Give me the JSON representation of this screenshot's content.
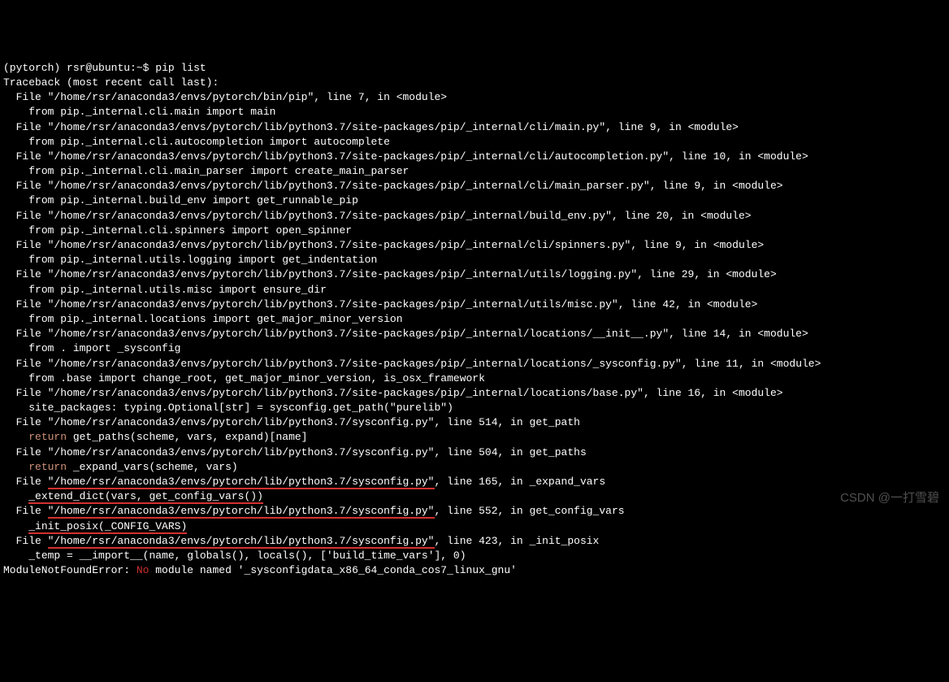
{
  "prompt": {
    "env": "(pytorch)",
    "user_host": "rsr@ubuntu",
    "path": "~",
    "symbol": "$",
    "command": "pip list"
  },
  "traceback": {
    "header": "Traceback (most recent call last):",
    "frames": [
      {
        "file": "\"/home/rsr/anaconda3/envs/pytorch/bin/pip\"",
        "line": "7",
        "func": "<module>",
        "code": "from pip._internal.cli.main import main"
      },
      {
        "file": "\"/home/rsr/anaconda3/envs/pytorch/lib/python3.7/site-packages/pip/_internal/cli/main.py\"",
        "line": "9",
        "func": "<module>",
        "code": "from pip._internal.cli.autocompletion import autocomplete"
      },
      {
        "file": "\"/home/rsr/anaconda3/envs/pytorch/lib/python3.7/site-packages/pip/_internal/cli/autocompletion.py\"",
        "line": "10",
        "func": "<module>",
        "code": "from pip._internal.cli.main_parser import create_main_parser"
      },
      {
        "file": "\"/home/rsr/anaconda3/envs/pytorch/lib/python3.7/site-packages/pip/_internal/cli/main_parser.py\"",
        "line": "9",
        "func": "<module>",
        "code": "from pip._internal.build_env import get_runnable_pip"
      },
      {
        "file": "\"/home/rsr/anaconda3/envs/pytorch/lib/python3.7/site-packages/pip/_internal/build_env.py\"",
        "line": "20",
        "func": "<module>",
        "code": "from pip._internal.cli.spinners import open_spinner"
      },
      {
        "file": "\"/home/rsr/anaconda3/envs/pytorch/lib/python3.7/site-packages/pip/_internal/cli/spinners.py\"",
        "line": "9",
        "func": "<module>",
        "code": "from pip._internal.utils.logging import get_indentation"
      },
      {
        "file": "\"/home/rsr/anaconda3/envs/pytorch/lib/python3.7/site-packages/pip/_internal/utils/logging.py\"",
        "line": "29",
        "func": "<module>",
        "code": "from pip._internal.utils.misc import ensure_dir"
      },
      {
        "file": "\"/home/rsr/anaconda3/envs/pytorch/lib/python3.7/site-packages/pip/_internal/utils/misc.py\"",
        "line": "42",
        "func": "<module>",
        "code": "from pip._internal.locations import get_major_minor_version"
      },
      {
        "file": "\"/home/rsr/anaconda3/envs/pytorch/lib/python3.7/site-packages/pip/_internal/locations/__init__.py\"",
        "line": "14",
        "func": "<module>",
        "code": "from . import _sysconfig"
      },
      {
        "file": "\"/home/rsr/anaconda3/envs/pytorch/lib/python3.7/site-packages/pip/_internal/locations/_sysconfig.py\"",
        "line": "11",
        "func": "<module>",
        "code": "from .base import change_root, get_major_minor_version, is_osx_framework"
      },
      {
        "file": "\"/home/rsr/anaconda3/envs/pytorch/lib/python3.7/site-packages/pip/_internal/locations/base.py\"",
        "line": "16",
        "func": "<module>",
        "code": "site_packages: typing.Optional[str] = sysconfig.get_path(\"purelib\")"
      },
      {
        "file": "\"/home/rsr/anaconda3/envs/pytorch/lib/python3.7/sysconfig.py\"",
        "line": "514",
        "func": "get_path",
        "return_kw": "return",
        "code_after_return": " get_paths(scheme, vars, expand)[name]"
      },
      {
        "file": "\"/home/rsr/anaconda3/envs/pytorch/lib/python3.7/sysconfig.py\"",
        "line": "504",
        "func": "get_paths",
        "return_kw": "return",
        "code_after_return": " _expand_vars(scheme, vars)"
      },
      {
        "file_underlined": "\"/home/rsr/anaconda3/envs/pytorch/lib/python3.7/sysconfig.py\"",
        "line": "165",
        "func": "_expand_vars",
        "code": "_extend_dict(vars, get_config_vars())"
      },
      {
        "file_underlined": "\"/home/rsr/anaconda3/envs/pytorch/lib/python3.7/sysconfig.py\"",
        "line": "552",
        "func": "get_config_vars",
        "code": "_init_posix(_CONFIG_VARS)"
      },
      {
        "file_underlined": "\"/home/rsr/anaconda3/envs/pytorch/lib/python3.7/sysconfig.py\"",
        "line": "423",
        "func": "_init_posix",
        "code": "_temp = __import__(name, globals(), locals(), ['build_time_vars'], 0)"
      }
    ],
    "error_type": "ModuleNotFoundError:",
    "error_no": "No",
    "error_rest": " module named '_sysconfigdata_x86_64_conda_cos7_linux_gnu'"
  },
  "watermark": "CSDN @一打雪碧"
}
